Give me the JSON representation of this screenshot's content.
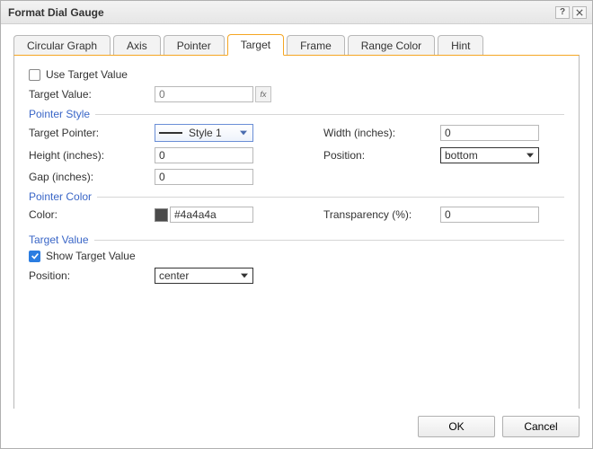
{
  "window": {
    "title": "Format Dial Gauge"
  },
  "tabs": [
    "Circular Graph",
    "Axis",
    "Pointer",
    "Target",
    "Frame",
    "Range Color",
    "Hint"
  ],
  "active_tab": "Target",
  "use_target": {
    "label": "Use Target Value",
    "checked": false
  },
  "target_value": {
    "label": "Target Value:",
    "value": "0",
    "fx": "fx"
  },
  "groups": {
    "pointer_style": "Pointer Style",
    "pointer_color": "Pointer Color",
    "target_value": "Target Value"
  },
  "pointer_style": {
    "target_pointer": {
      "label": "Target Pointer:",
      "value": "Style 1"
    },
    "width": {
      "label": "Width (inches):",
      "value": "0"
    },
    "height": {
      "label": "Height (inches):",
      "value": "0"
    },
    "position": {
      "label": "Position:",
      "value": "bottom"
    },
    "gap": {
      "label": "Gap (inches):",
      "value": "0"
    }
  },
  "pointer_color": {
    "color": {
      "label": "Color:",
      "hex": "#4a4a4a"
    },
    "transparency": {
      "label": "Transparency (%):",
      "value": "0"
    }
  },
  "target_value_section": {
    "show": {
      "label": "Show Target Value",
      "checked": true
    },
    "position": {
      "label": "Position:",
      "value": "center"
    }
  },
  "buttons": {
    "ok": "OK",
    "cancel": "Cancel"
  }
}
